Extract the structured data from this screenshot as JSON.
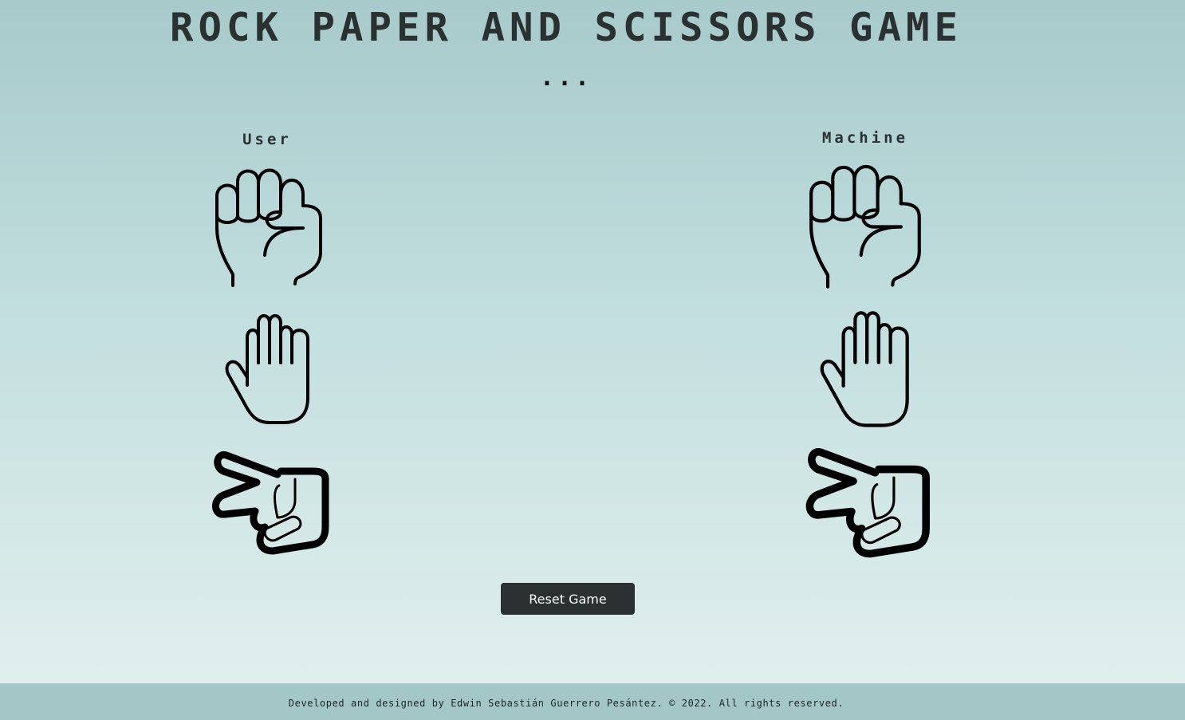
{
  "header": {
    "title": "ROCK PAPER AND SCISSORS GAME",
    "result_text": "..."
  },
  "players": {
    "user": {
      "label": "User",
      "choices": [
        {
          "name": "rock",
          "icon": "rock-fist-icon"
        },
        {
          "name": "paper",
          "icon": "paper-hand-icon"
        },
        {
          "name": "scissors",
          "icon": "scissors-hand-icon"
        }
      ]
    },
    "machine": {
      "label": "Machine",
      "choices": [
        {
          "name": "rock",
          "icon": "rock-fist-icon"
        },
        {
          "name": "paper",
          "icon": "paper-hand-icon"
        },
        {
          "name": "scissors",
          "icon": "scissors-hand-icon"
        }
      ]
    }
  },
  "controls": {
    "reset_label": "Reset Game"
  },
  "footer": {
    "text": "Developed and designed by Edwin Sebastián Guerrero Pesántez. © 2022. All rights reserved."
  },
  "colors": {
    "background_top": "#a7cacb",
    "background_bottom": "#e3f1ee",
    "text_dark": "#2b3130",
    "button_bg": "#2b3130",
    "footer_bg": "#a3c6c7"
  }
}
